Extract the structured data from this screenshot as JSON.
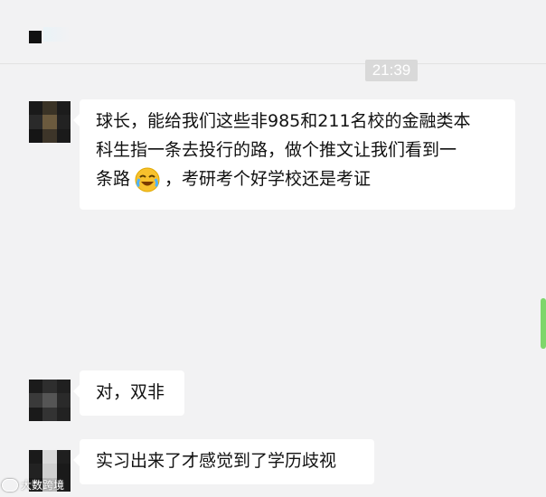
{
  "header": {
    "icon": "back-icon"
  },
  "timestamp": "21:39",
  "messages": [
    {
      "line1": "球长，能给我们这些非985和211名校的金融类本",
      "line2": "科生指一条去投行的路，做个推文让我们看到一",
      "line3_a": "条路",
      "emoji": "laughing-crying-emoji",
      "line3_b": "，考研考个好学校还是考证"
    },
    {
      "text": "对，双非"
    },
    {
      "text": "实习出来了才感觉到了学历歧视"
    }
  ],
  "watermark": {
    "text": "大数跨境",
    "icon": "weibo-logo-icon"
  },
  "colors": {
    "background": "#f2f2f3",
    "bubble": "#ffffff",
    "timestamp_bg": "#d9d9d9",
    "scrollbar": "#7ed66b"
  }
}
